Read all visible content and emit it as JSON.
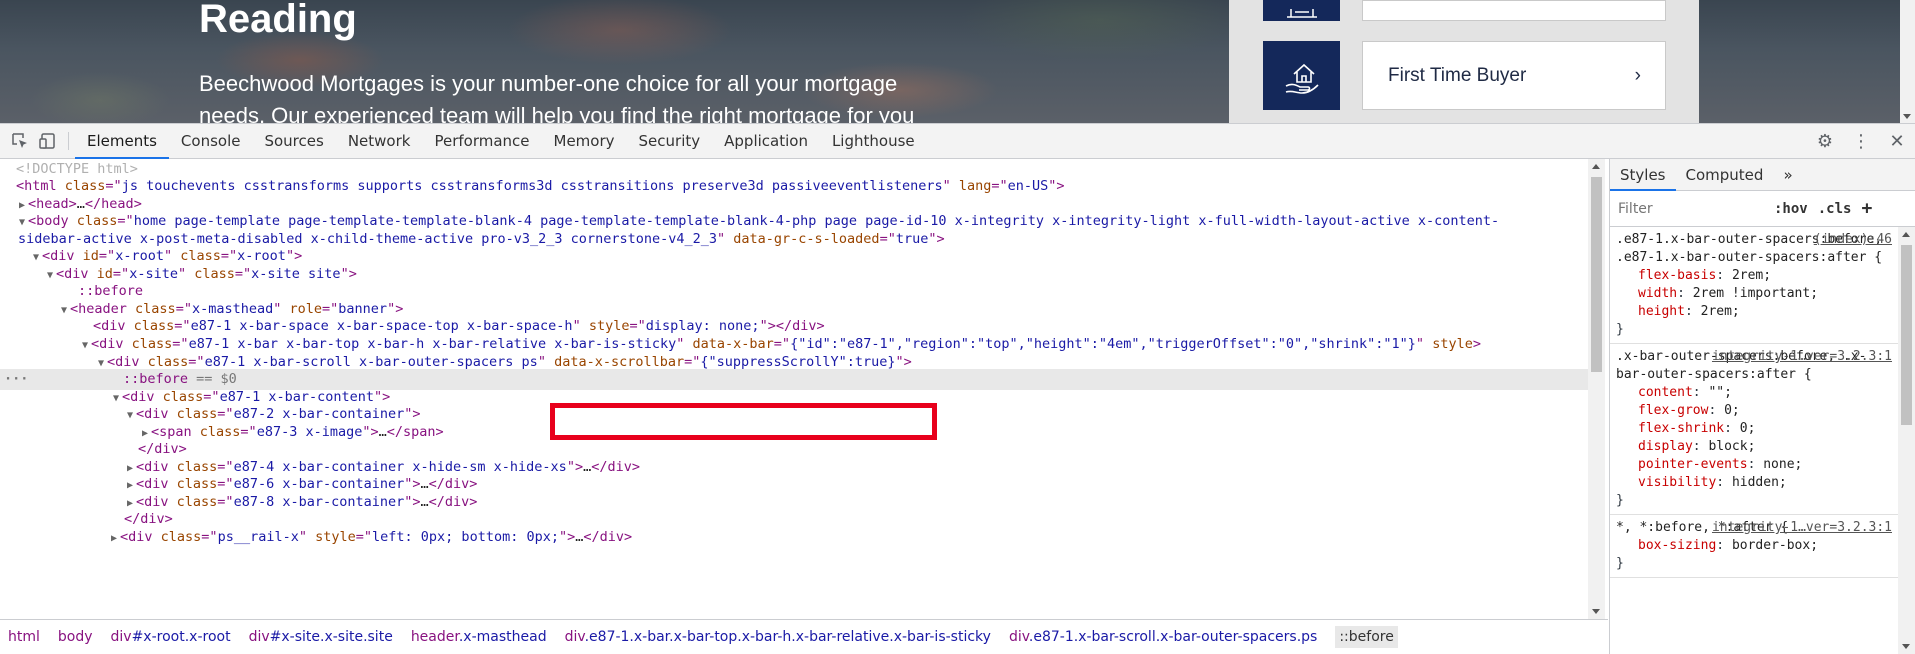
{
  "site": {
    "hero_title": "Reading",
    "hero_text_line1": "Beechwood Mortgages is your number-one choice for all your mortgage",
    "hero_text_line2": "needs. Our experienced team will help you find the right mortgage for you",
    "card_label": "First Time Buyer"
  },
  "devtools": {
    "tabs": [
      "Elements",
      "Console",
      "Sources",
      "Network",
      "Performance",
      "Memory",
      "Security",
      "Application",
      "Lighthouse"
    ],
    "active_tab": "Elements",
    "tree": {
      "doctype": "<!DOCTYPE html>",
      "html_class": "js touchevents csstransforms supports csstransforms3d csstransitions preserve3d passiveeventlisteners",
      "html_lang": "en-US",
      "head": "…",
      "body_class_1": "home page-template page-template-template-blank-4 page-template-template-blank-4-php page page-id-10 x-integrity x-integrity-light x-full-width-layout-active x-content-",
      "body_class_2": "sidebar-active x-post-meta-disabled x-child-theme-active pro-v3_2_3 cornerstone-v4_2_3",
      "body_gr": "true",
      "xroot_id": "x-root",
      "xroot_class": "x-root",
      "xsite_id": "x-site",
      "xsite_class": "x-site site",
      "before": "::before",
      "header_class": "x-masthead",
      "header_role": "banner",
      "space_class": "e87-1 x-bar-space x-bar-space-top x-bar-space-h",
      "space_style": "display: none;",
      "bar_class": "e87-1 x-bar x-bar-top x-bar-h x-bar-relative x-bar-is-sticky",
      "bar_data": "{\"id\":\"e87-1\",\"region\":\"top\",\"height\":\"4em\",\"triggerOffset\":\"0\",\"shrink\":\"1\"}",
      "scroll_class": "e87-1 x-bar-scroll x-bar-outer-spacers ps",
      "scroll_data": "{\"suppressScrollY\":true}",
      "selected_before": "::before",
      "selected_eq": "== $0",
      "content_class": "e87-1 x-bar-content",
      "container2_class": "e87-2 x-bar-container",
      "span_class": "e87-3 x-image",
      "container4_class": "e87-4 x-bar-container  x-hide-sm x-hide-xs",
      "container6_class": "e87-6 x-bar-container",
      "container8_class": "e87-8 x-bar-container",
      "rail_class": "ps__rail-x",
      "rail_style": "left: 0px; bottom: 0px;",
      "ellipsis": "…"
    },
    "breadcrumbs": [
      {
        "tag": "html",
        "rest": ""
      },
      {
        "tag": "body",
        "rest": ""
      },
      {
        "tag": "div",
        "rest": "#x-root.x-root"
      },
      {
        "tag": "div",
        "rest": "#x-site.x-site.site"
      },
      {
        "tag": "header",
        "rest": ".x-masthead"
      },
      {
        "tag": "div",
        "rest": ".e87-1.x-bar.x-bar-top.x-bar-h.x-bar-relative.x-bar-is-sticky"
      },
      {
        "tag": "div",
        "rest": ".e87-1.x-bar-scroll.x-bar-outer-spacers.ps"
      },
      {
        "tag": "::before",
        "rest": ""
      }
    ],
    "styles": {
      "tabs": [
        "Styles",
        "Computed"
      ],
      "more": "»",
      "filter_placeholder": "Filter",
      "hov": ":hov",
      "cls": ".cls",
      "add": "+",
      "rules": [
        {
          "selector": ".e87-1.x-bar-outer-spacers:before, .e87-1.x-bar-outer-spacers:after {",
          "source": "(index):46",
          "props": [
            [
              "flex-basis",
              "2rem;"
            ],
            [
              "width",
              "2rem !important;"
            ],
            [
              "height",
              "2rem;"
            ]
          ]
        },
        {
          "selector": ".x-bar-outer-spacers:before, .x-bar-outer-spacers:after {",
          "source": "integrity-1…ver=3.2.3:1",
          "props": [
            [
              "content",
              "\"\";"
            ],
            [
              "flex-grow",
              "0;"
            ],
            [
              "flex-shrink",
              "0;"
            ],
            [
              "display",
              "block;"
            ],
            [
              "pointer-events",
              "none;"
            ],
            [
              "visibility",
              "hidden;"
            ]
          ]
        },
        {
          "selector": "*, *:before, *:after {",
          "source": "integrity-1…ver=3.2.3:1",
          "props": [
            [
              "box-sizing",
              "border-box;"
            ]
          ]
        }
      ],
      "close_brace": "}"
    }
  }
}
